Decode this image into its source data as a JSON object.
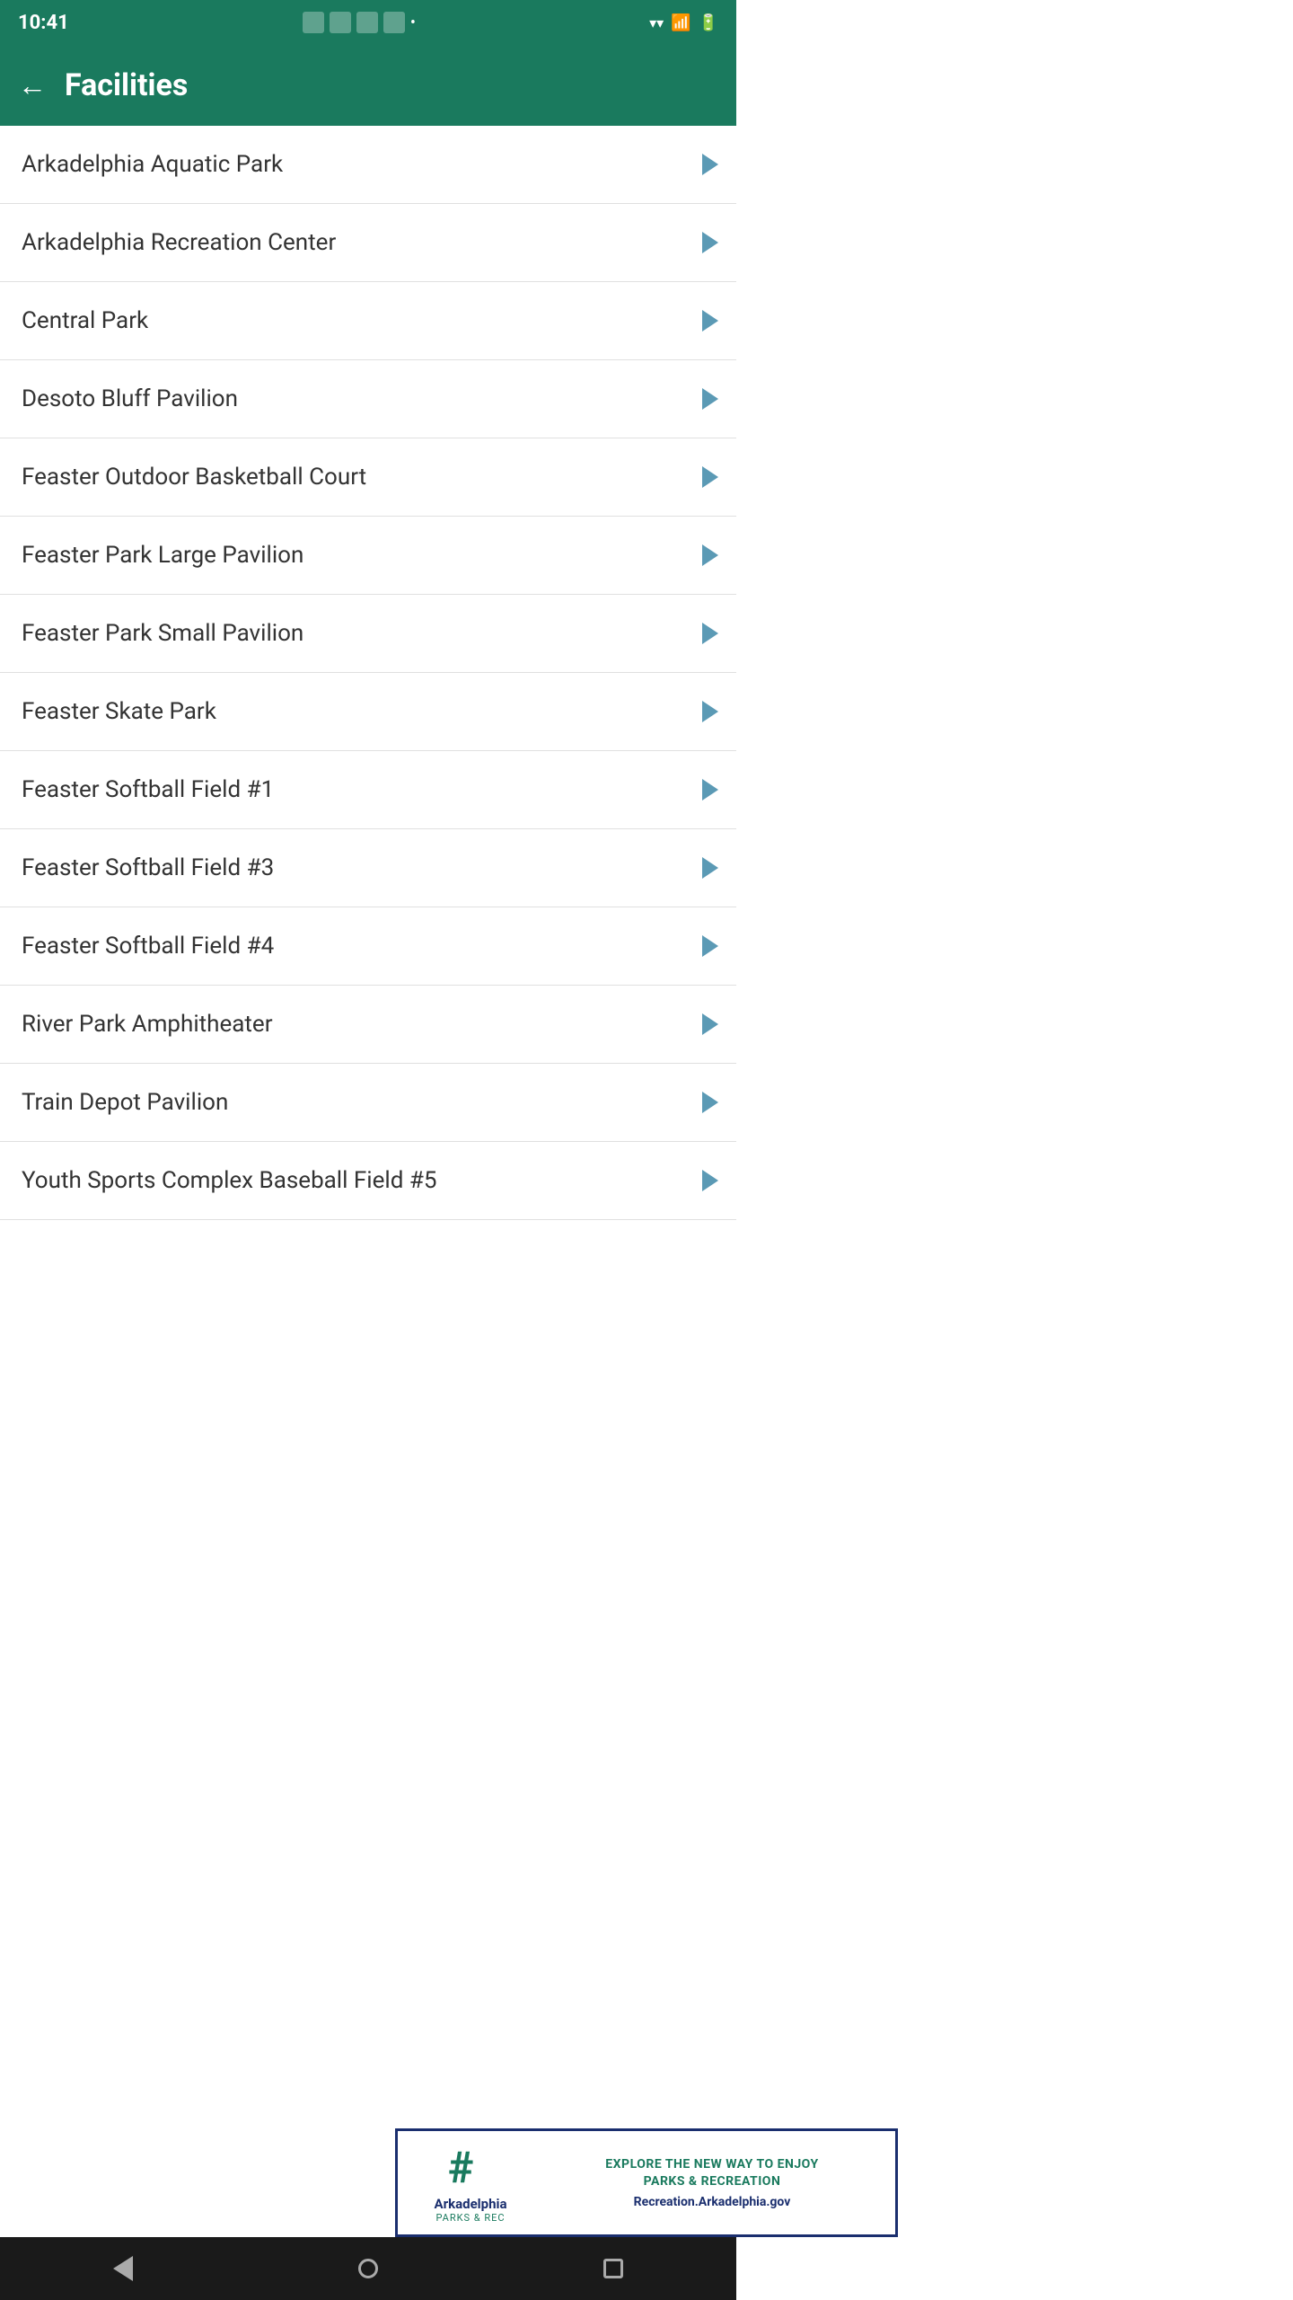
{
  "statusBar": {
    "time": "10:41",
    "wifiStrength": "full",
    "signalStrength": "medium",
    "batteryLevel": "full"
  },
  "header": {
    "backLabel": "←",
    "title": "Facilities"
  },
  "facilities": [
    {
      "id": 1,
      "name": "Arkadelphia Aquatic Park"
    },
    {
      "id": 2,
      "name": "Arkadelphia Recreation Center"
    },
    {
      "id": 3,
      "name": "Central Park"
    },
    {
      "id": 4,
      "name": "Desoto Bluff Pavilion"
    },
    {
      "id": 5,
      "name": "Feaster Outdoor Basketball Court"
    },
    {
      "id": 6,
      "name": "Feaster Park Large Pavilion"
    },
    {
      "id": 7,
      "name": "Feaster Park Small Pavilion"
    },
    {
      "id": 8,
      "name": "Feaster Skate Park"
    },
    {
      "id": 9,
      "name": "Feaster Softball Field #1"
    },
    {
      "id": 10,
      "name": "Feaster Softball Field #3"
    },
    {
      "id": 11,
      "name": "Feaster Softball Field #4"
    },
    {
      "id": 12,
      "name": "River Park Amphitheater"
    },
    {
      "id": 13,
      "name": "Train Depot Pavilion"
    },
    {
      "id": 14,
      "name": "Youth Sports Complex Baseball Field #5"
    }
  ],
  "adBanner": {
    "logoText": "Arkadelphia",
    "logoSubText": "PARKS & REC",
    "tagline": "EXPLORE THE NEW WAY TO ENJOY\nPARKS & RECREATION",
    "url": "Recreation.Arkadelphia.gov"
  },
  "colors": {
    "headerBg": "#1a7a5e",
    "chevronColor": "#5b9ab5",
    "adBorderColor": "#1a2e6e",
    "adTaglineColor": "#1a7a5e",
    "adUrlColor": "#1a2e6e"
  }
}
